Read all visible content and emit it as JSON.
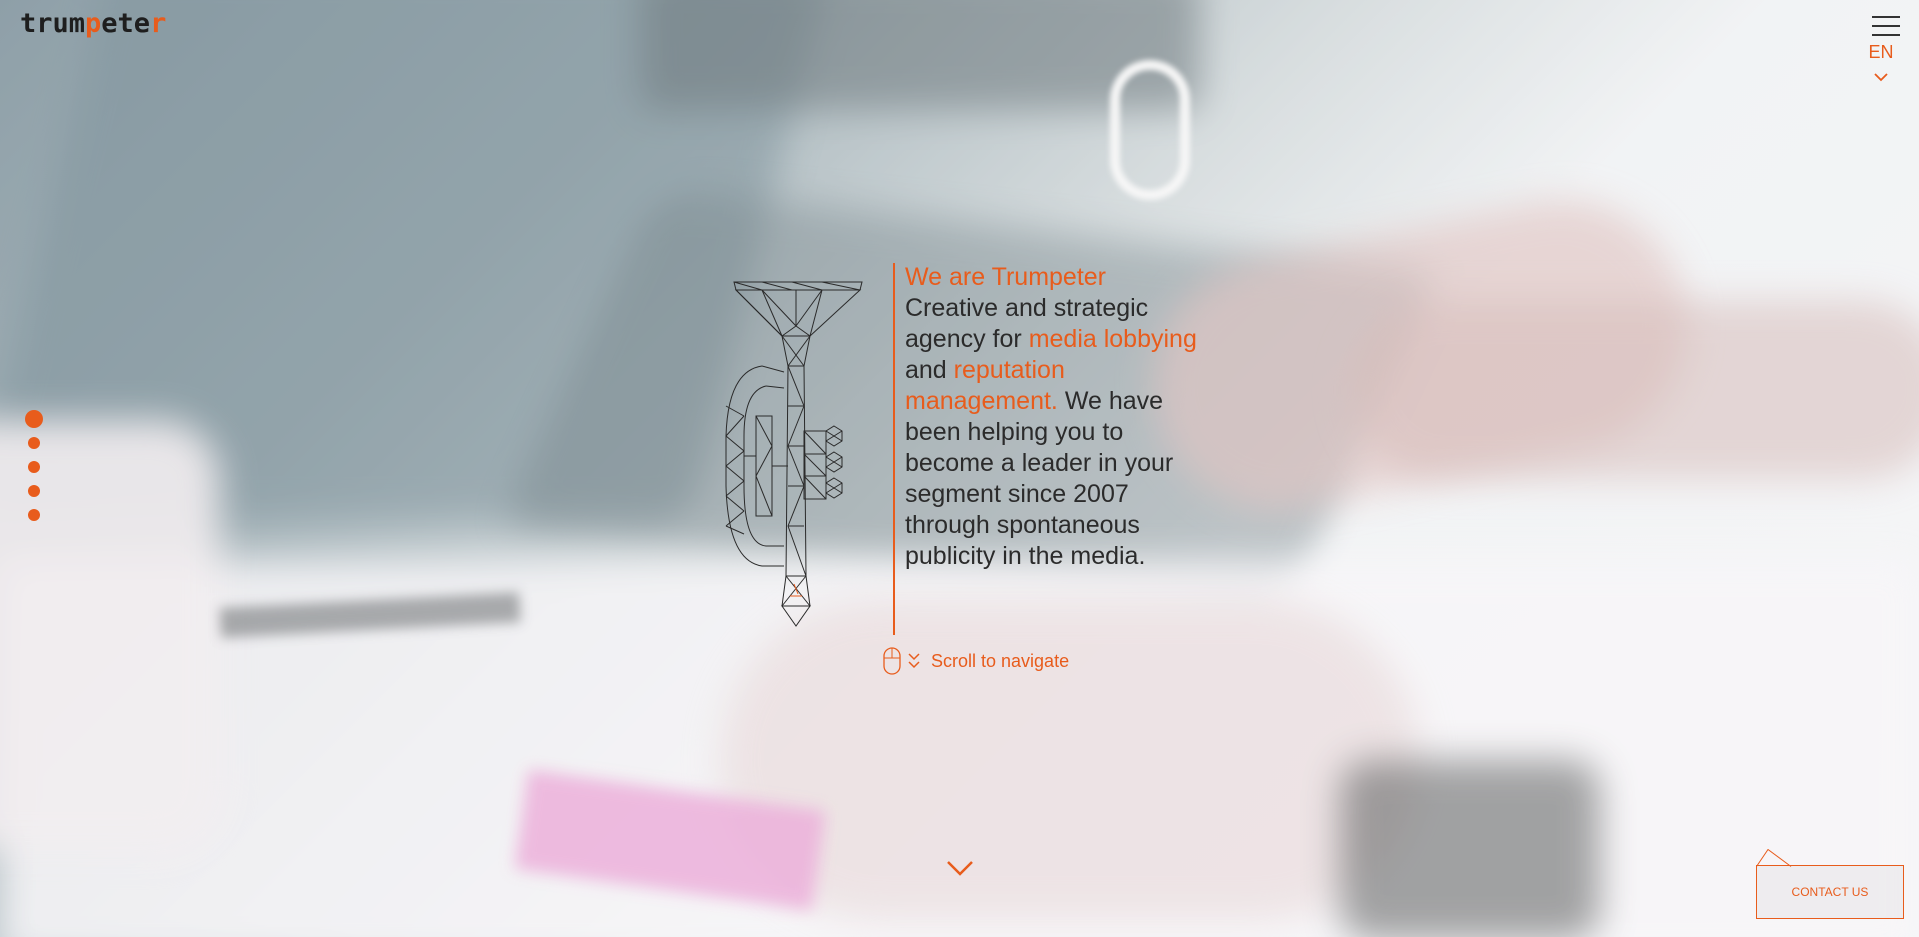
{
  "header": {
    "logo_parts": [
      "trum",
      "p",
      "ete",
      "r"
    ],
    "language": "EN"
  },
  "side_nav": {
    "sections": 5,
    "active_index": 0
  },
  "hero": {
    "title": "We are Trumpeter",
    "segments": [
      {
        "text": "Creative and strategic agency for ",
        "highlight": false
      },
      {
        "text": "media lobbying",
        "highlight": true
      },
      {
        "text": " and ",
        "highlight": false
      },
      {
        "text": "reputation management.",
        "highlight": true
      },
      {
        "text": " We have been helping you to become a leader in your segment since 2007 through spontaneous publicity in the media.",
        "highlight": false
      }
    ]
  },
  "scroll_hint": {
    "label": "Scroll to navigate"
  },
  "contact_button": {
    "label": "CONTACT US"
  },
  "colors": {
    "accent": "#e85c1c",
    "text": "#2b2b2b"
  },
  "icons": [
    "menu-icon",
    "chevron-down-icon",
    "trumpet-illustration",
    "mouse-icon",
    "double-chevron-down-icon"
  ]
}
